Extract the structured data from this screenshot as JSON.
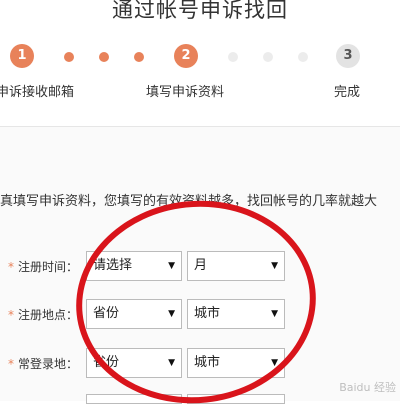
{
  "page": {
    "title": "通过帐号申诉找回"
  },
  "steps": [
    {
      "number": "1",
      "label": "申诉接收邮箱"
    },
    {
      "number": "2",
      "label": "填写申诉资料"
    },
    {
      "number": "3",
      "label": "完成"
    }
  ],
  "intro_text": "真填写申诉资料，您填写的有效资料越多，找回帐号的几率就越大",
  "form": {
    "rows": [
      {
        "label": "注册时间：",
        "first": "请选择",
        "second": "月"
      },
      {
        "label": "注册地点：",
        "first": "省份",
        "second": "城市"
      },
      {
        "label": "常登录地：",
        "first": "省份",
        "second": "城市"
      }
    ],
    "required_mark": "*",
    "arrow_glyph": "▼"
  },
  "watermark": "Baidu 经验",
  "colors": {
    "accent": "#e8825a",
    "annotation": "#d9141b"
  }
}
